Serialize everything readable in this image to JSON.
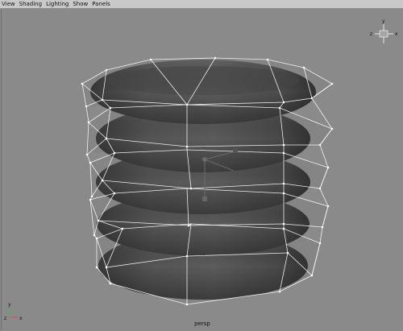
{
  "menu": {
    "items": [
      "View",
      "Shading",
      "Lighting",
      "Show",
      "Panels"
    ]
  },
  "viewport": {
    "camera_label": "persp",
    "view_cube": {
      "y": "y",
      "x": "x",
      "z": "z"
    },
    "axis_gizmo": {
      "y": "y",
      "x": "x",
      "z": "z"
    }
  },
  "colors": {
    "menubar": "#c9c9c9",
    "viewport_bg": "#8a8a8a",
    "mesh": "#4f4f4f",
    "cage": "#ffffff"
  }
}
